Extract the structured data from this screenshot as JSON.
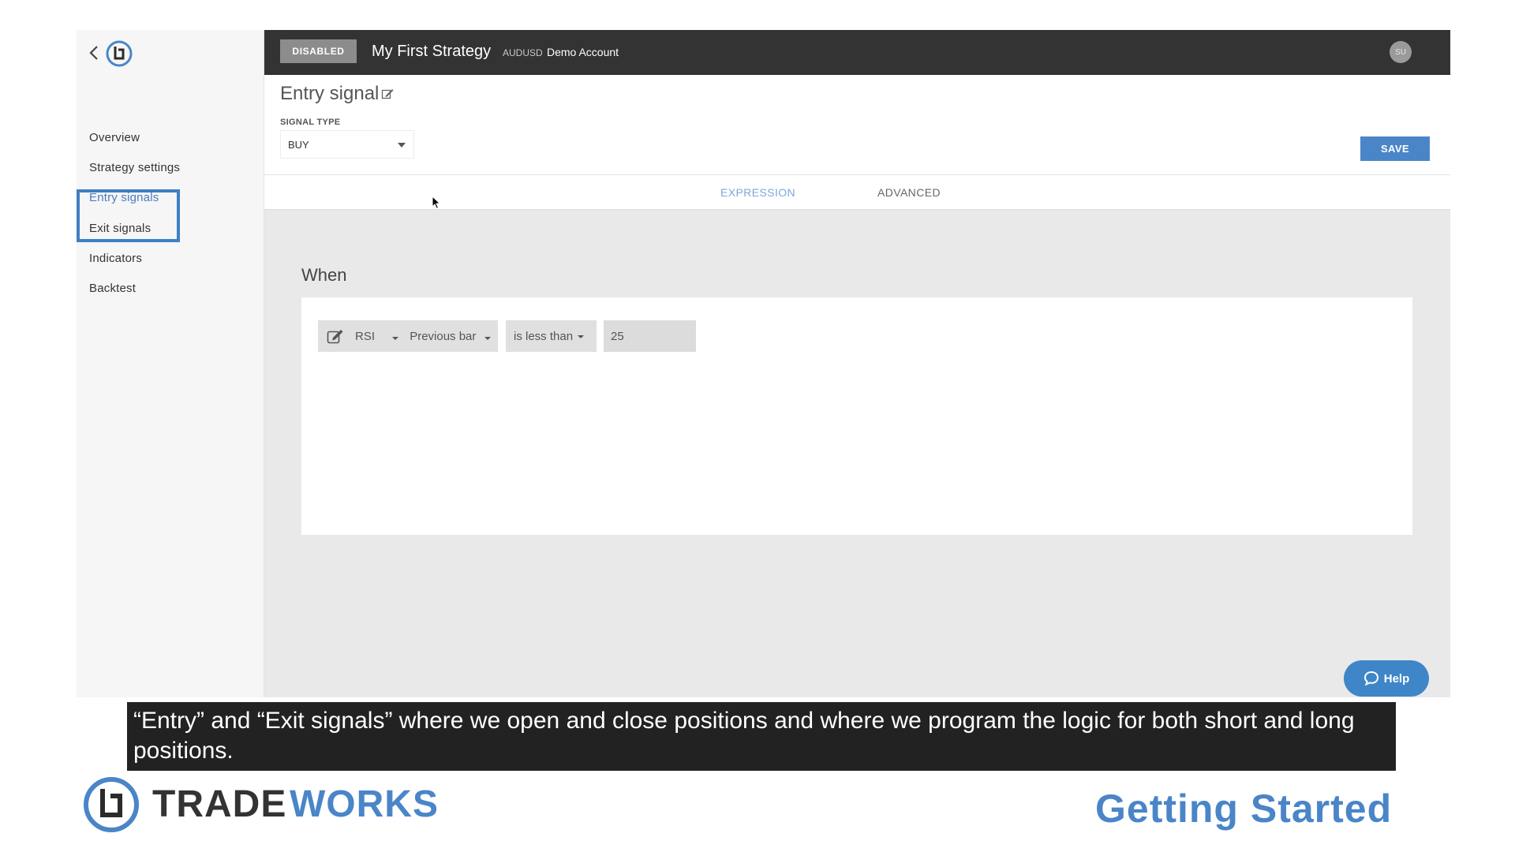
{
  "topbar": {
    "status_badge": "DISABLED",
    "strategy_name": "My First Strategy",
    "symbol": "AUDUSD",
    "account": "Demo Account",
    "avatar_initials": "SU"
  },
  "sidebar": {
    "items": [
      {
        "label": "Overview"
      },
      {
        "label": "Strategy settings"
      },
      {
        "label": "Entry signals"
      },
      {
        "label": "Exit signals"
      },
      {
        "label": "Indicators"
      },
      {
        "label": "Backtest"
      }
    ],
    "active_item": "Entry signals"
  },
  "header": {
    "title": "Entry signal",
    "signal_type_label": "SIGNAL TYPE",
    "signal_type_value": "BUY",
    "save_label": "SAVE"
  },
  "tabs": [
    {
      "label": "EXPRESSION",
      "active": true
    },
    {
      "label": "ADVANCED",
      "active": false
    }
  ],
  "content": {
    "when_label": "When",
    "expression": {
      "indicator": "RSI",
      "bar": "Previous bar",
      "operator": "is less than",
      "value": "25"
    },
    "help_label": "Help"
  },
  "subtitle": "“Entry” and “Exit signals” where we open and close positions and where we program the logic for both short and long positions.",
  "footer": {
    "brand_trade": "TRADE",
    "brand_works": "WORKS",
    "section_title": "Getting Started"
  },
  "colors": {
    "accent": "#4a85c8",
    "topbar": "#333333",
    "highlight_box": "#3f7fc4",
    "subtitle_bg": "#222222"
  },
  "icons": [
    "back-chevron-icon",
    "tradeworks-logo-icon",
    "edit-icon",
    "dropdown-caret-icon",
    "chat-bubble-icon",
    "mouse-cursor-icon"
  ]
}
